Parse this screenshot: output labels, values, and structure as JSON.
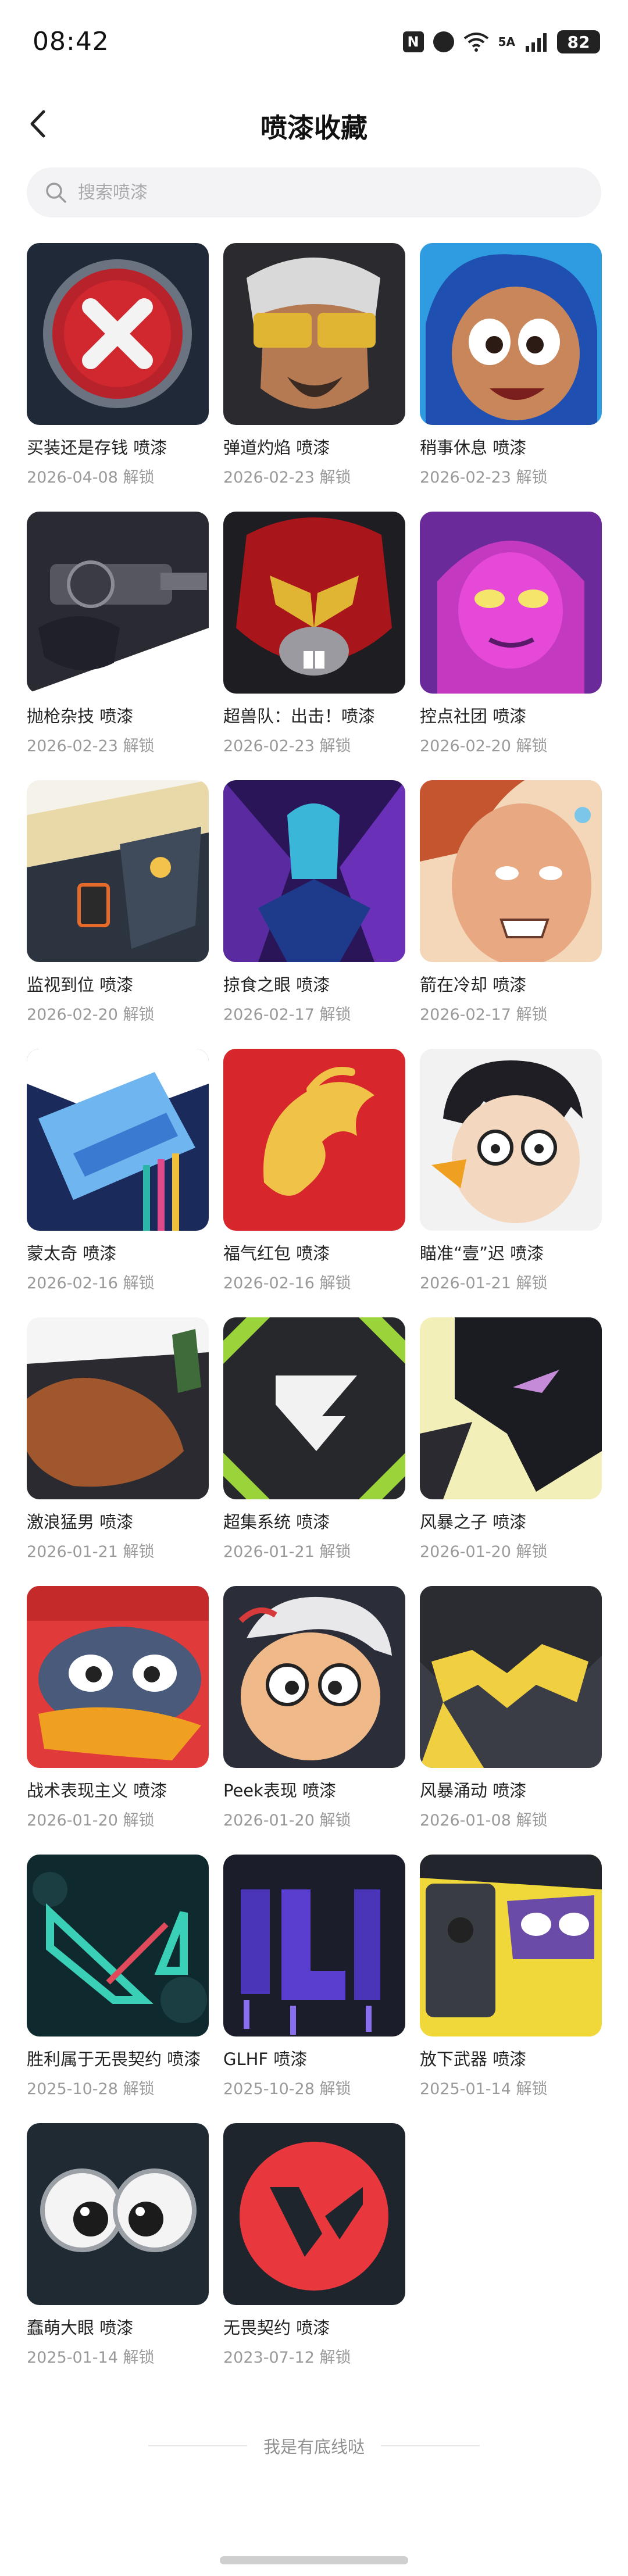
{
  "status_bar": {
    "time": "08:42",
    "nfc": "N",
    "signal": "5A",
    "battery": "82"
  },
  "header": {
    "title": "喷漆收藏"
  },
  "search": {
    "placeholder": "搜索喷漆"
  },
  "items": [
    {
      "name": "买装还是存钱 喷漆",
      "meta": "2026-04-08 解锁"
    },
    {
      "name": "弹道灼焰 喷漆",
      "meta": "2026-02-23 解锁"
    },
    {
      "name": "稍事休息 喷漆",
      "meta": "2026-02-23 解锁"
    },
    {
      "name": "抛枪杂技 喷漆",
      "meta": "2026-02-23 解锁"
    },
    {
      "name": "超兽队：出击！喷漆",
      "meta": "2026-02-23 解锁"
    },
    {
      "name": "控点社团 喷漆",
      "meta": "2026-02-20 解锁"
    },
    {
      "name": "监视到位 喷漆",
      "meta": "2026-02-20 解锁"
    },
    {
      "name": "掠食之眼 喷漆",
      "meta": "2026-02-17 解锁"
    },
    {
      "name": "箭在冷却 喷漆",
      "meta": "2026-02-17 解锁"
    },
    {
      "name": "蒙太奇 喷漆",
      "meta": "2026-02-16 解锁"
    },
    {
      "name": "福气红包 喷漆",
      "meta": "2026-02-16 解锁"
    },
    {
      "name": "瞄准“壹”迟 喷漆",
      "meta": "2026-01-21 解锁"
    },
    {
      "name": "激浪猛男 喷漆",
      "meta": "2026-01-21 解锁"
    },
    {
      "name": "超集系统 喷漆",
      "meta": "2026-01-21 解锁"
    },
    {
      "name": "风暴之子 喷漆",
      "meta": "2026-01-20 解锁"
    },
    {
      "name": "战术表现主义 喷漆",
      "meta": "2026-01-20 解锁"
    },
    {
      "name": "Peek表现 喷漆",
      "meta": "2026-01-20 解锁"
    },
    {
      "name": "风暴涌动 喷漆",
      "meta": "2026-01-08 解锁"
    },
    {
      "name": "胜利属于无畏契约 喷漆",
      "meta": "2025-10-28 解锁"
    },
    {
      "name": "GLHF 喷漆",
      "meta": "2025-10-28 解锁"
    },
    {
      "name": "放下武器 喷漆",
      "meta": "2025-01-14 解锁"
    },
    {
      "name": "蠢萌大眼 喷漆",
      "meta": "2025-01-14 解锁"
    },
    {
      "name": "无畏契约 喷漆",
      "meta": "2023-07-12 解锁"
    }
  ],
  "footer": {
    "text": "我是有底线哒"
  }
}
